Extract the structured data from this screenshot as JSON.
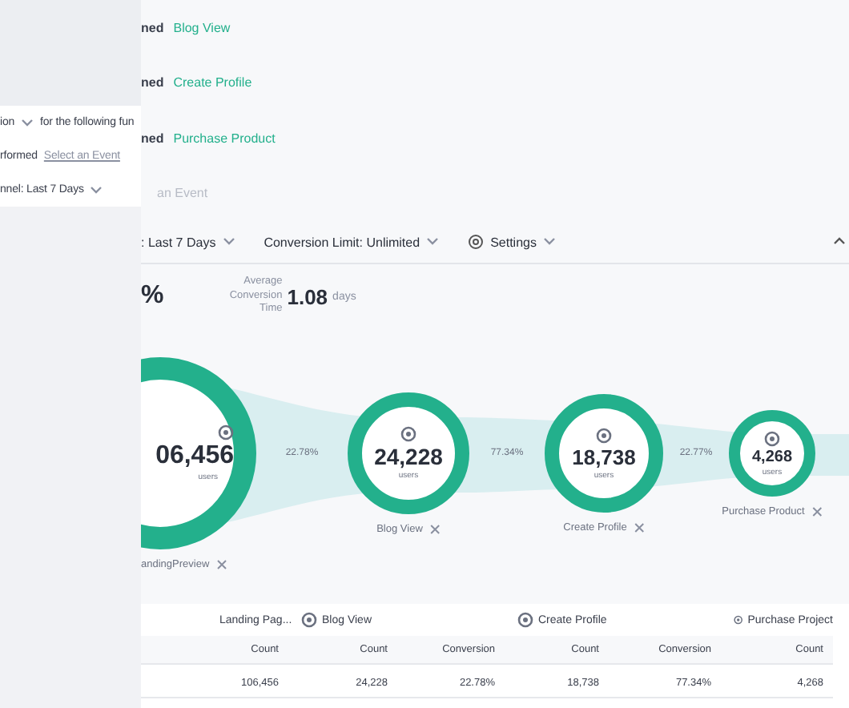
{
  "query_panel": {
    "metric": "ion",
    "funnel_text": "for the following fun",
    "performed_label": "rformed",
    "event_placeholder": "Select an Event",
    "window_label": "nnel: Last 7 Days"
  },
  "steps": [
    {
      "prefix": "ned",
      "event": "Blog View"
    },
    {
      "prefix": "ned",
      "event": "Create Profile"
    },
    {
      "prefix": "ned",
      "event": "Purchase Product"
    }
  ],
  "add_step": "an Event",
  "toolbar": [
    {
      "kind": "dropdown",
      "label": ": Last 7 Days"
    },
    {
      "kind": "dropdown",
      "label": "Conversion Limit: Unlimited"
    },
    {
      "kind": "settings",
      "label": "Settings"
    }
  ],
  "summary": {
    "conversion_partial": "%",
    "label": "Average Conversion Time",
    "value": "1.08",
    "unit": "days"
  },
  "funnel": {
    "steps": [
      {
        "count": "06,456",
        "unit": "users",
        "label": "andingPreview"
      },
      {
        "count": "24,228",
        "unit": "users",
        "label": "Blog View"
      },
      {
        "count": "18,738",
        "unit": "users",
        "label": "Create Profile"
      },
      {
        "count": "4,268",
        "unit": "users",
        "label": "Purchase Product"
      }
    ],
    "conversions": [
      "22.78%",
      "77.34%",
      "22.77%"
    ]
  },
  "table": {
    "groups": [
      {
        "name": "Landing Pag...",
        "columns": [
          {
            "header": "Count",
            "value": "106,456"
          }
        ]
      },
      {
        "name": "Blog View",
        "columns": [
          {
            "header": "Count",
            "value": "24,228"
          },
          {
            "header": "Conversion",
            "value": "22.78%"
          }
        ]
      },
      {
        "name": "Create Profile",
        "columns": [
          {
            "header": "Count",
            "value": "18,738"
          },
          {
            "header": "Conversion",
            "value": "77.34%"
          }
        ]
      },
      {
        "name": "Purchase Project",
        "columns": [
          {
            "header": "Count",
            "value": "4,268"
          }
        ]
      }
    ]
  }
}
